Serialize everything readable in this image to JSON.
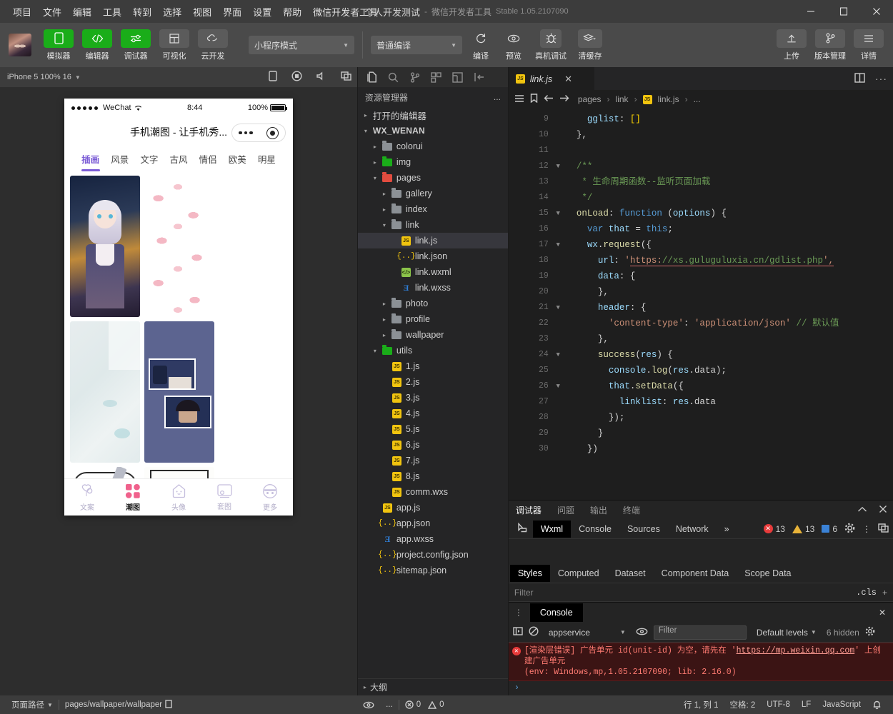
{
  "window": {
    "menus": [
      "项目",
      "文件",
      "编辑",
      "工具",
      "转到",
      "选择",
      "视图",
      "界面",
      "设置",
      "帮助",
      "微信开发者工具"
    ],
    "project_name": "个人开发测试",
    "separator": "-",
    "app_name": "微信开发者工具",
    "version": "Stable 1.05.2107090",
    "controls": {
      "minimize": "–",
      "maximize": "▢",
      "close": "✕"
    }
  },
  "toolbar": {
    "buttons": [
      {
        "label": "模拟器",
        "icon": "phone-icon",
        "active": true
      },
      {
        "label": "编辑器",
        "icon": "code-icon",
        "active": true
      },
      {
        "label": "调试器",
        "icon": "sliders-icon",
        "active": true
      },
      {
        "label": "可视化",
        "icon": "layout-icon",
        "active": false
      },
      {
        "label": "云开发",
        "icon": "cloud-icon",
        "active": false
      }
    ],
    "mode_select": "小程序模式",
    "compile_select": "普通编译",
    "actions": [
      {
        "label": "编译",
        "icon": "refresh-icon"
      },
      {
        "label": "预览",
        "icon": "eye-icon"
      },
      {
        "label": "真机调试",
        "icon": "bug-icon"
      },
      {
        "label": "清缓存",
        "icon": "layers-icon"
      }
    ],
    "right_actions": [
      {
        "label": "上传",
        "icon": "upload-icon"
      },
      {
        "label": "版本管理",
        "icon": "branch-icon"
      },
      {
        "label": "详情",
        "icon": "menu-icon"
      }
    ]
  },
  "simulator": {
    "device_label": "iPhone 5 100% 16",
    "toolbar_icons": [
      "rotate-icon",
      "record-icon",
      "volume-icon",
      "window-icon"
    ],
    "phone": {
      "carrier": "WeChat",
      "time": "8:44",
      "battery": "100%",
      "page_title": "手机潮图 - 让手机秀...",
      "tabs": [
        "插画",
        "风景",
        "文字",
        "古风",
        "情侣",
        "欧美",
        "明星"
      ],
      "active_tab_index": 0,
      "tabbar": [
        {
          "label": "文案",
          "icon": "balloon-icon",
          "active": false
        },
        {
          "label": "潮图",
          "icon": "grid-icon",
          "active": true
        },
        {
          "label": "头像",
          "icon": "avatar-icon",
          "active": false
        },
        {
          "label": "套图",
          "icon": "album-icon",
          "active": false
        },
        {
          "label": "更多",
          "icon": "more-icon",
          "active": false
        }
      ]
    }
  },
  "explorer": {
    "activity_icons": [
      "files-icon",
      "search-icon",
      "source-control-icon",
      "extensions-icon",
      "snippets-icon",
      "collapse-icon"
    ],
    "title": "资源管理器",
    "more": "...",
    "outline_label": "大纲",
    "tree": [
      {
        "label": "打开的编辑器",
        "depth": 0,
        "type": "section",
        "twisty": "▸",
        "bold": false
      },
      {
        "label": "WX_WENAN",
        "depth": 0,
        "type": "root",
        "twisty": "▾",
        "bold": true
      },
      {
        "label": "colorui",
        "depth": 1,
        "type": "folder",
        "twisty": "▸",
        "color": "grey"
      },
      {
        "label": "img",
        "depth": 1,
        "type": "folder",
        "twisty": "▸",
        "color": "green"
      },
      {
        "label": "pages",
        "depth": 1,
        "type": "folder-open",
        "twisty": "▾",
        "color": "red"
      },
      {
        "label": "gallery",
        "depth": 2,
        "type": "folder",
        "twisty": "▸",
        "color": "grey"
      },
      {
        "label": "index",
        "depth": 2,
        "type": "folder",
        "twisty": "▸",
        "color": "grey"
      },
      {
        "label": "link",
        "depth": 2,
        "type": "folder-open",
        "twisty": "▾",
        "color": "grey"
      },
      {
        "label": "link.js",
        "depth": 3,
        "type": "js",
        "selected": true
      },
      {
        "label": "link.json",
        "depth": 3,
        "type": "json"
      },
      {
        "label": "link.wxml",
        "depth": 3,
        "type": "wxml"
      },
      {
        "label": "link.wxss",
        "depth": 3,
        "type": "wxss"
      },
      {
        "label": "photo",
        "depth": 2,
        "type": "folder",
        "twisty": "▸",
        "color": "grey"
      },
      {
        "label": "profile",
        "depth": 2,
        "type": "folder",
        "twisty": "▸",
        "color": "grey"
      },
      {
        "label": "wallpaper",
        "depth": 2,
        "type": "folder",
        "twisty": "▸",
        "color": "grey"
      },
      {
        "label": "utils",
        "depth": 1,
        "type": "folder-open",
        "twisty": "▾",
        "color": "green"
      },
      {
        "label": "1.js",
        "depth": 2,
        "type": "js"
      },
      {
        "label": "2.js",
        "depth": 2,
        "type": "js"
      },
      {
        "label": "3.js",
        "depth": 2,
        "type": "js"
      },
      {
        "label": "4.js",
        "depth": 2,
        "type": "js"
      },
      {
        "label": "5.js",
        "depth": 2,
        "type": "js"
      },
      {
        "label": "6.js",
        "depth": 2,
        "type": "js"
      },
      {
        "label": "7.js",
        "depth": 2,
        "type": "js"
      },
      {
        "label": "8.js",
        "depth": 2,
        "type": "js"
      },
      {
        "label": "comm.wxs",
        "depth": 2,
        "type": "js"
      },
      {
        "label": "app.js",
        "depth": 1,
        "type": "js"
      },
      {
        "label": "app.json",
        "depth": 1,
        "type": "json"
      },
      {
        "label": "app.wxss",
        "depth": 1,
        "type": "wxss"
      },
      {
        "label": "project.config.json",
        "depth": 1,
        "type": "json"
      },
      {
        "label": "sitemap.json",
        "depth": 1,
        "type": "json"
      }
    ]
  },
  "editor": {
    "tab": {
      "label": "link.js",
      "icon": "js-icon",
      "close": "✕"
    },
    "tab_right_icons": [
      "split-editor-icon",
      "more-actions-icon"
    ],
    "breadcrumb": [
      "pages",
      "link",
      "link.js",
      "..."
    ],
    "breadcrumb_icons": [
      "outline-icon",
      "bookmark-icon",
      "back-icon",
      "forward-icon"
    ],
    "first_line_number": 9,
    "lines": [
      {
        "n": 9,
        "text": "    gglist: []",
        "fold": false
      },
      {
        "n": 10,
        "text": "  },",
        "fold": false
      },
      {
        "n": 11,
        "text": "",
        "fold": false
      },
      {
        "n": 12,
        "text": "  /**",
        "fold": true
      },
      {
        "n": 13,
        "text": "   * 生命周期函数--监听页面加载",
        "fold": false
      },
      {
        "n": 14,
        "text": "   */",
        "fold": false
      },
      {
        "n": 15,
        "text": "  onLoad: function (options) {",
        "fold": true
      },
      {
        "n": 16,
        "text": "    var that = this;",
        "fold": false
      },
      {
        "n": 17,
        "text": "    wx.request({",
        "fold": true
      },
      {
        "n": 18,
        "text": "      url: 'https://xs.guluguluxia.cn/gdlist.php',",
        "fold": false
      },
      {
        "n": 19,
        "text": "      data: {",
        "fold": false
      },
      {
        "n": 20,
        "text": "      },",
        "fold": false
      },
      {
        "n": 21,
        "text": "      header: {",
        "fold": true
      },
      {
        "n": 22,
        "text": "        'content-type': 'application/json' // 默认值",
        "fold": false
      },
      {
        "n": 23,
        "text": "      },",
        "fold": false
      },
      {
        "n": 24,
        "text": "      success(res) {",
        "fold": true
      },
      {
        "n": 25,
        "text": "        console.log(res.data);",
        "fold": false
      },
      {
        "n": 26,
        "text": "        that.setData({",
        "fold": true
      },
      {
        "n": 27,
        "text": "          linklist: res.data",
        "fold": false
      },
      {
        "n": 28,
        "text": "        });",
        "fold": false
      },
      {
        "n": 29,
        "text": "      }",
        "fold": false
      },
      {
        "n": 30,
        "text": "    })",
        "fold": false
      }
    ]
  },
  "devtools": {
    "panel_tabs": [
      "调试器",
      "问题",
      "输出",
      "终端"
    ],
    "panel_active": "调试器",
    "panel_controls": [
      "collapse-icon",
      "close-icon"
    ],
    "inspector_tabs": [
      "Wxml",
      "Console",
      "Sources",
      "Network"
    ],
    "inspector_active": "Wxml",
    "overflow": "»",
    "counts": {
      "errors": "13",
      "warnings": "13",
      "info": "6"
    },
    "right_icons": [
      "settings-gear-icon",
      "kebab-menu-icon",
      "dock-icon"
    ],
    "style_tabs": [
      "Styles",
      "Computed",
      "Dataset",
      "Component Data",
      "Scope Data"
    ],
    "style_active": "Styles",
    "filter_placeholder": "Filter",
    "cls_label": ".cls",
    "add_label": "+"
  },
  "console": {
    "tab": "Console",
    "drag_handle": "⋮",
    "close": "✕",
    "toolbar_icons": [
      "sidebar-toggle-icon",
      "clear-console-icon",
      "eye-icon",
      "settings-gear-icon"
    ],
    "context_select": "appservice",
    "filter_placeholder": "Filter",
    "levels_select": "Default levels",
    "hidden_label": "6 hidden",
    "messages": [
      {
        "level": "error",
        "pre": "[渲染层错误] 广告单元 id(unit-id) 为空，请先在 '",
        "link": "https://mp.weixin.qq.com",
        "post": "' 上创建广告单元",
        "env": "(env: Windows,mp,1.05.2107090; lib: 2.16.0)"
      }
    ],
    "prompt": "›"
  },
  "statusbar": {
    "left_label": "页面路径",
    "page_path": "pages/wallpaper/wallpaper",
    "copy_icon": "copy-icon",
    "eye_icon": "eye-icon",
    "more": "...",
    "problems": {
      "errors": "0",
      "warnings": "0"
    },
    "cursor": "行 1, 列 1",
    "indent": "空格: 2",
    "encoding": "UTF-8",
    "eol": "LF",
    "language": "JavaScript",
    "bell_icon": "bell-icon"
  },
  "colors": {
    "accent_green": "#1aad19",
    "accent_purple": "#7b5cd6",
    "error_red": "#e83b3b",
    "warn_yellow": "#e8b339",
    "info_blue": "#3b82d6"
  }
}
